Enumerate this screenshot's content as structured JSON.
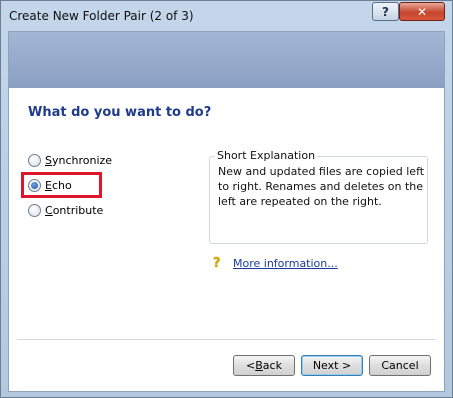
{
  "window": {
    "title": "Create New Folder Pair (2 of 3)"
  },
  "title_buttons": {
    "help": "?",
    "close": "✕"
  },
  "question": "What do you want to do?",
  "options": [
    {
      "label_pre": "",
      "label_accel": "S",
      "label_post": "ynchronize",
      "checked": false
    },
    {
      "label_pre": "",
      "label_accel": "E",
      "label_post": "cho",
      "checked": true
    },
    {
      "label_pre": "",
      "label_accel": "C",
      "label_post": "ontribute",
      "checked": false
    }
  ],
  "explanation": {
    "legend": "Short Explanation",
    "text": "New and updated files are copied left to right. Renames and deletes on the left are repeated on the right."
  },
  "more_info": {
    "icon": "?",
    "label": "More information..."
  },
  "buttons": {
    "back_pre": "< ",
    "back_accel": "B",
    "back_post": "ack",
    "next": "Next >",
    "cancel": "Cancel"
  },
  "colors": {
    "highlight": "#e0152a",
    "heading": "#1e3b8c",
    "link": "#1a3d9c"
  }
}
